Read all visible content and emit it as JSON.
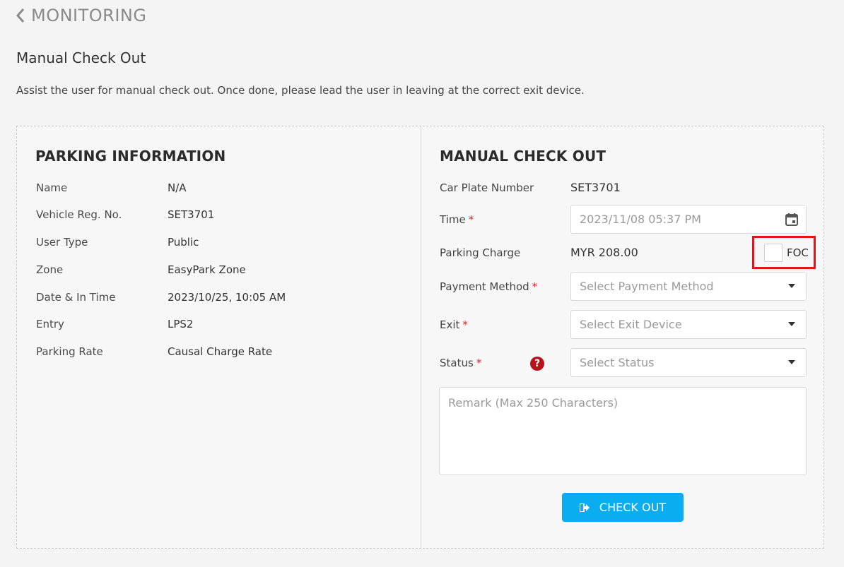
{
  "header": {
    "back_title": "MONITORING",
    "page_title": "Manual Check Out",
    "description": "Assist the user for manual check out. Once done, please lead the user in leaving at the correct exit device."
  },
  "parking_info": {
    "title": "PARKING INFORMATION",
    "rows": [
      {
        "label": "Name",
        "value": "N/A"
      },
      {
        "label": "Vehicle Reg. No.",
        "value": "SET3701"
      },
      {
        "label": "User Type",
        "value": "Public"
      },
      {
        "label": "Zone",
        "value": "EasyPark Zone"
      },
      {
        "label": "Date & In Time",
        "value": "2023/10/25, 10:05 AM"
      },
      {
        "label": "Entry",
        "value": "LPS2"
      },
      {
        "label": "Parking Rate",
        "value": "Causal Charge Rate"
      }
    ]
  },
  "checkout_form": {
    "title": "MANUAL CHECK OUT",
    "car_plate_label": "Car Plate Number",
    "car_plate_value": "SET3701",
    "time_label": "Time",
    "time_value": "2023/11/08 05:37 PM",
    "parking_charge_label": "Parking Charge",
    "parking_charge_value": "MYR 208.00",
    "foc_label": "FOC",
    "payment_method_label": "Payment Method",
    "payment_method_placeholder": "Select Payment Method",
    "exit_label": "Exit",
    "exit_placeholder": "Select Exit Device",
    "status_label": "Status",
    "status_placeholder": "Select Status",
    "help_glyph": "?",
    "remark_placeholder": "Remark (Max 250 Characters)",
    "required_mark": "*",
    "checkout_button": "CHECK OUT"
  },
  "colors": {
    "accent": "#0aaef0",
    "required": "#d9252b",
    "highlight": "#e0161c",
    "help_icon": "#b5141b"
  },
  "icons": {
    "back": "chevron-left-icon",
    "calendar": "calendar-icon",
    "help": "question-circle-icon",
    "checkout": "sign-out-icon",
    "dropdown": "caret-down-icon"
  }
}
